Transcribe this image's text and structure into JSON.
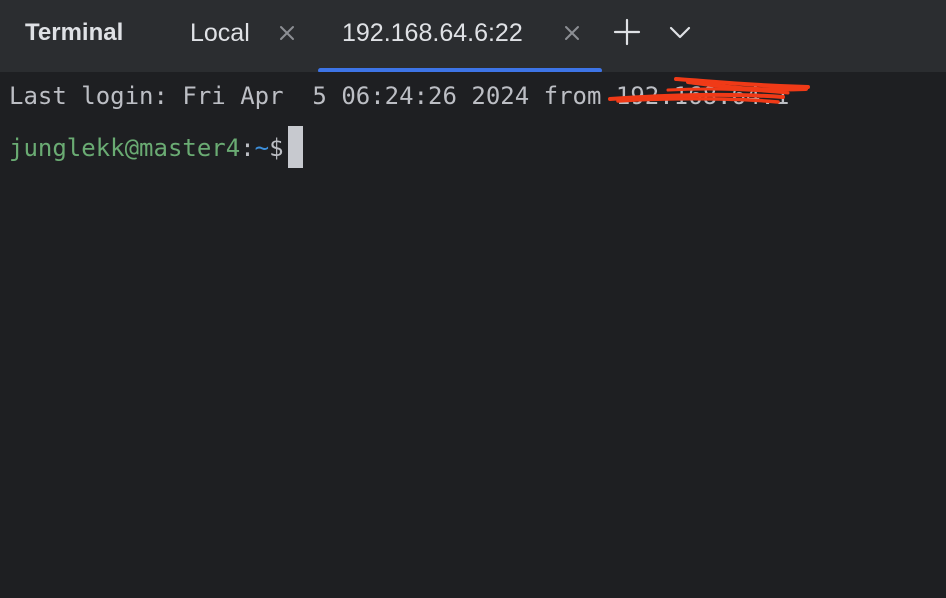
{
  "tabbar": {
    "title": "Terminal",
    "tabs": [
      {
        "label": "Local",
        "active": false
      },
      {
        "label": "192.168.64.6:22",
        "active": true
      }
    ],
    "accent_color": "#3d74e6"
  },
  "icons": {
    "close": "close-icon",
    "add": "plus-icon",
    "menu": "chevron-down-icon"
  },
  "terminal": {
    "last_login_prefix": "Last login: Fri Apr  5 06:24:26 2024 from ",
    "last_login_ip": "192.168.64.1",
    "prompt_user_host": "junglekk@master4",
    "prompt_sep": ":",
    "prompt_path": "~",
    "prompt_symbol": "$",
    "colors": {
      "user": "#6aab73",
      "path": "#3d8fdb",
      "redaction": "#f03a17"
    }
  }
}
